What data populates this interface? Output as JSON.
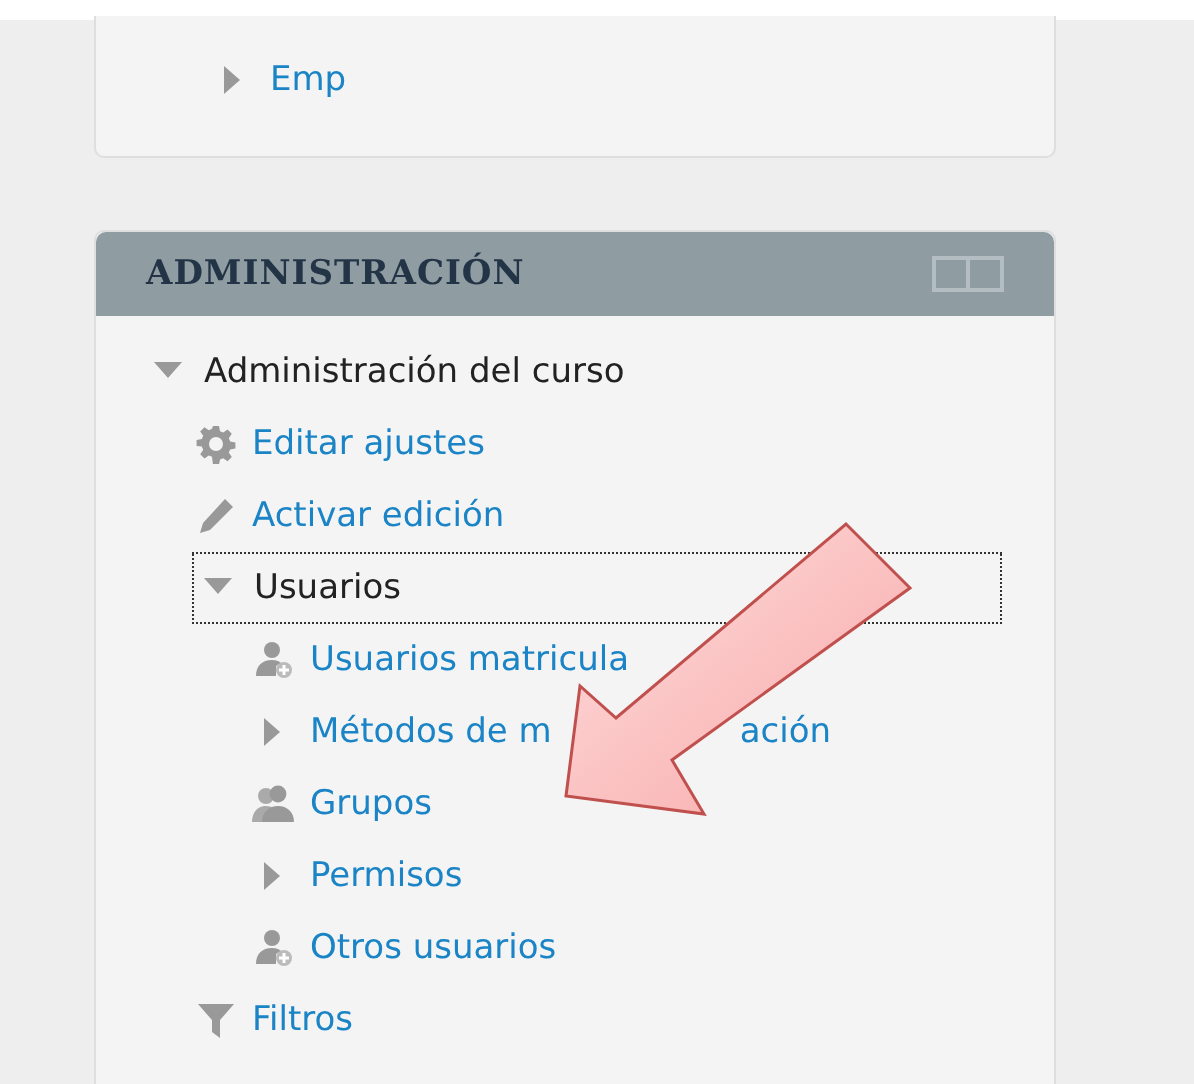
{
  "blocks": [
    {
      "items": [
        {
          "label": "Emp",
          "kind": "caret",
          "expanded": false,
          "link": true,
          "focused": false
        }
      ]
    },
    {
      "title": "ADMINISTRACIÓN",
      "items": [
        {
          "label": "Administración del curso",
          "kind": "caret",
          "expanded": true,
          "link": false,
          "focused": false,
          "children": [
            {
              "label": "Editar ajustes",
              "kind": "gear",
              "link": true,
              "focused": false
            },
            {
              "label": "Activar edición",
              "kind": "pencil",
              "link": true,
              "focused": false
            },
            {
              "label": "Usuarios",
              "kind": "caret",
              "expanded": true,
              "link": false,
              "focused": true,
              "children": [
                {
                  "label": "Usuarios matricula",
                  "kind": "userplus",
                  "link": true,
                  "focused": false
                },
                {
                  "label": "Métodos de m",
                  "label_after": "ación",
                  "kind": "caret",
                  "expanded": false,
                  "link": true,
                  "focused": false
                },
                {
                  "label": "Grupos",
                  "kind": "users",
                  "link": true,
                  "focused": false
                },
                {
                  "label": "Permisos",
                  "kind": "caret",
                  "expanded": false,
                  "link": true,
                  "focused": false
                },
                {
                  "label": "Otros usuarios",
                  "kind": "userplus",
                  "link": true,
                  "focused": false
                }
              ]
            },
            {
              "label": "Filtros",
              "kind": "filter",
              "link": true,
              "focused": false
            }
          ]
        }
      ]
    }
  ]
}
